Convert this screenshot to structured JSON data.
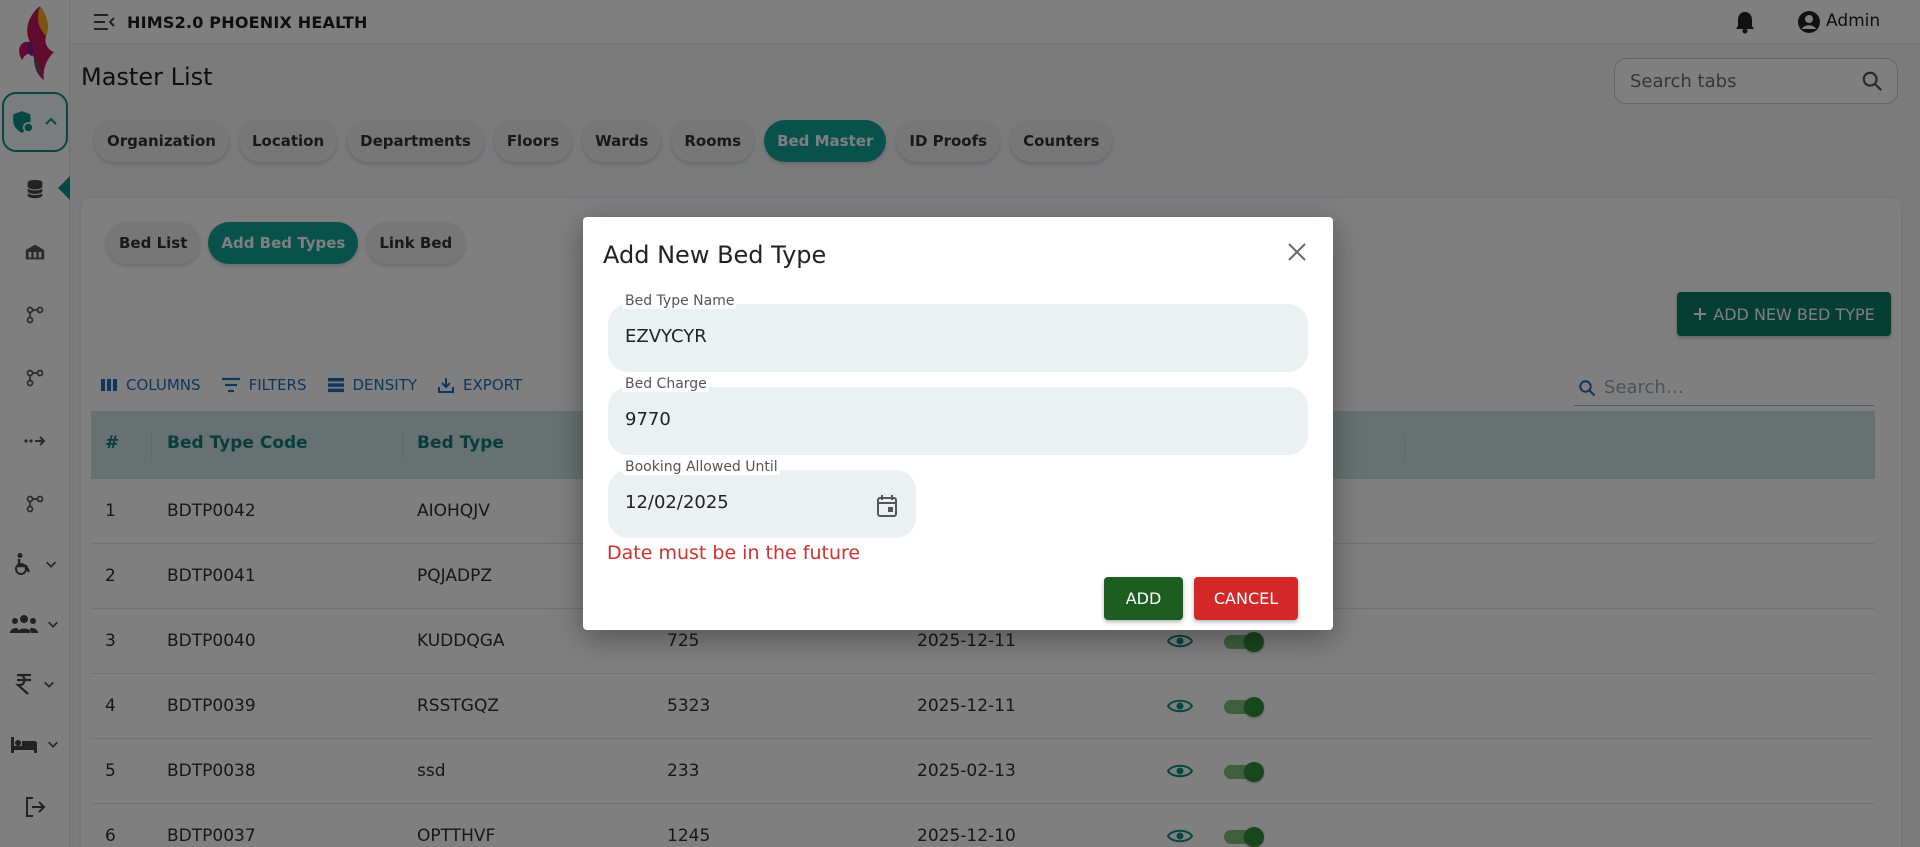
{
  "app": {
    "title": "HIMS2.0 PHOENIX HEALTH",
    "user": "Admin"
  },
  "colors": {
    "accent": "#10a39a",
    "add_button": "#1c5e1f",
    "cancel_button": "#d42828",
    "error": "#d32f2f",
    "toggle_on": "#2f8f3a"
  },
  "page": {
    "title": "Master List",
    "search_placeholder": "Search tabs"
  },
  "tabs": [
    {
      "label": "Organization",
      "active": false
    },
    {
      "label": "Location",
      "active": false
    },
    {
      "label": "Departments",
      "active": false
    },
    {
      "label": "Floors",
      "active": false
    },
    {
      "label": "Wards",
      "active": false
    },
    {
      "label": "Rooms",
      "active": false
    },
    {
      "label": "Bed Master",
      "active": true
    },
    {
      "label": "ID Proofs",
      "active": false
    },
    {
      "label": "Counters",
      "active": false
    }
  ],
  "subtabs": [
    {
      "label": "Bed List",
      "active": false
    },
    {
      "label": "Add Bed Types",
      "active": true
    },
    {
      "label": "Link Bed",
      "active": false
    }
  ],
  "add_new_button": "ADD NEW BED TYPE",
  "toolbar": {
    "columns": "COLUMNS",
    "filters": "FILTERS",
    "density": "DENSITY",
    "export": "EXPORT",
    "search_placeholder": "Search…"
  },
  "table": {
    "headers": [
      "#",
      "Bed Type Code",
      "Bed Type"
    ],
    "rows": [
      {
        "num": "1",
        "code": "BDTP0042",
        "type": "AIOHQJV",
        "charge": "",
        "date": ""
      },
      {
        "num": "2",
        "code": "BDTP0041",
        "type": "PQJADPZ",
        "charge": "",
        "date": ""
      },
      {
        "num": "3",
        "code": "BDTP0040",
        "type": "KUDDQGA",
        "charge": "725",
        "date": "2025-12-11"
      },
      {
        "num": "4",
        "code": "BDTP0039",
        "type": "RSSTGQZ",
        "charge": "5323",
        "date": "2025-12-11"
      },
      {
        "num": "5",
        "code": "BDTP0038",
        "type": "ssd",
        "charge": "233",
        "date": "2025-02-13"
      },
      {
        "num": "6",
        "code": "BDTP0037",
        "type": "OPTTHVF",
        "charge": "1245",
        "date": "2025-12-10"
      }
    ]
  },
  "modal": {
    "title": "Add New Bed Type",
    "fields": {
      "name": {
        "label": "Bed Type Name",
        "value": "EZVYCYR"
      },
      "charge": {
        "label": "Bed Charge",
        "value": "9770"
      },
      "date": {
        "label": "Booking Allowed Until",
        "value": "12/02/2025"
      }
    },
    "error": "Date must be in the future",
    "add_label": "ADD",
    "cancel_label": "CANCEL"
  }
}
